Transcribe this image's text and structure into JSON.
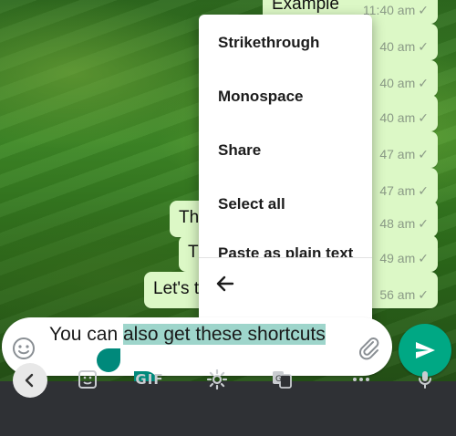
{
  "chat": {
    "messages": [
      {
        "text": "Example",
        "time": "11:40 am"
      },
      {
        "text": "",
        "time": "40 am"
      },
      {
        "text": "",
        "time": "40 am"
      },
      {
        "text": "",
        "time": "40 am"
      },
      {
        "text": "",
        "time": "47 am"
      },
      {
        "text": "",
        "time": "47 am"
      },
      {
        "text": "Th",
        "time": "48 am"
      },
      {
        "text": "T",
        "time": "49 am"
      },
      {
        "text": "Let's t",
        "time": "56 am"
      }
    ]
  },
  "context_menu": {
    "items": [
      "Strikethrough",
      "Monospace",
      "Share",
      "Select all",
      "Paste as plain text"
    ]
  },
  "compose": {
    "text_plain": "You can ",
    "text_selected": "also get these short",
    "text_selected_cont": "cuts"
  },
  "colors": {
    "bubble": "#dcf8c6",
    "send": "#00a884",
    "selection": "#9ed5cb",
    "handle": "#00897b"
  },
  "keyboard_toolbar": {
    "gif_label": "GIF",
    "icons": [
      "back-arrow-icon",
      "sticker-icon",
      "gif",
      "gear-icon",
      "translate-icon",
      "more-icon",
      "microphone-icon"
    ]
  }
}
